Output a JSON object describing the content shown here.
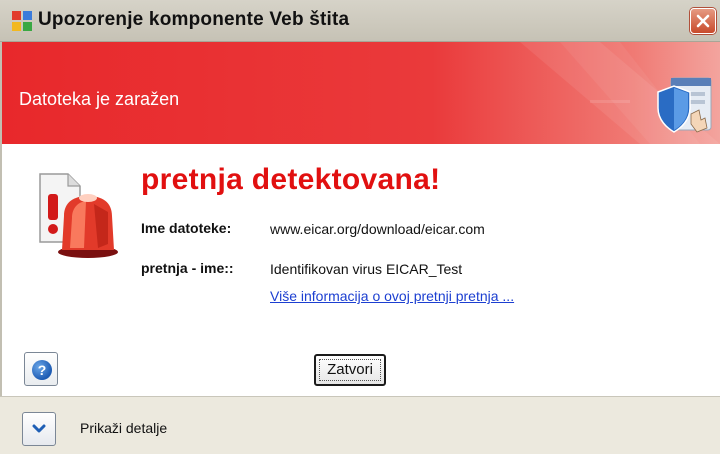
{
  "window": {
    "title": "Upozorenje komponente Veb štita",
    "close_icon": "close-icon"
  },
  "banner": {
    "title": "Datoteka je zaražen",
    "icon": "shield-icon"
  },
  "alert": {
    "icon": "alarm-siren-icon",
    "heading": "pretnja detektovana!",
    "file_label": "Ime datoteke:",
    "file_value": "www.eicar.org/download/eicar.com",
    "threat_label": "pretnja - ime::",
    "threat_value": "Identifikovan virus EICAR_Test",
    "more_info_link": "Više informacija o ovoj pretnji pretnja ..."
  },
  "buttons": {
    "help_icon": "question-icon",
    "close_label": "Zatvori"
  },
  "footer": {
    "expand_icon": "chevron-down-icon",
    "details_label": "Prikaži detalje"
  },
  "colors": {
    "banner_red": "#e8282b",
    "heading_red": "#e11010",
    "link_blue": "#1c3fd1"
  }
}
